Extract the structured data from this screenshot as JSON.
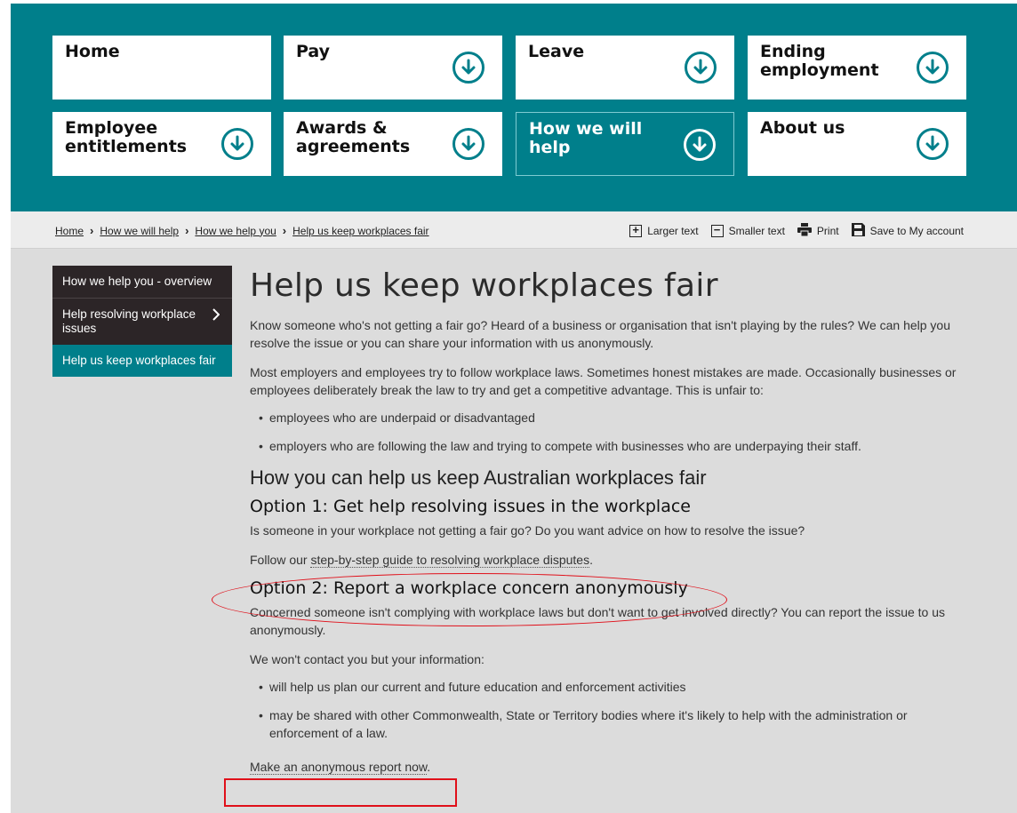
{
  "nav": {
    "tiles": [
      {
        "label": "Home",
        "has_icon": false
      },
      {
        "label": "Pay",
        "has_icon": true
      },
      {
        "label": "Leave",
        "has_icon": true
      },
      {
        "label": "Ending employment",
        "has_icon": true
      },
      {
        "label": "Employee entitlements",
        "has_icon": true
      },
      {
        "label": "Awards & agreements",
        "has_icon": true
      },
      {
        "label": "How we will help",
        "has_icon": true,
        "active": true
      },
      {
        "label": "About us",
        "has_icon": true
      }
    ],
    "icon": "down-arrow-circle-icon",
    "accent_color": "#007f8b"
  },
  "breadcrumb": {
    "items": [
      "Home",
      "How we will help",
      "How we help you",
      "Help us keep workplaces fair"
    ]
  },
  "tools": {
    "larger": "Larger text",
    "smaller": "Smaller text",
    "print": "Print",
    "save": "Save to My account"
  },
  "sidenav": {
    "items": [
      {
        "label": "How we help you - overview"
      },
      {
        "label": "Help resolving workplace issues"
      },
      {
        "label": "Help us keep workplaces fair"
      }
    ]
  },
  "main": {
    "title": "Help us keep workplaces fair",
    "intro": "Know someone who's not getting a fair go? Heard of a business or organisation that isn't playing by the rules? We can help you resolve the issue or you can share your information with us anonymously.",
    "para2": "Most employers and employees try to follow workplace laws. Sometimes honest mistakes are made. Occasionally businesses or employees deliberately break the law to try and get a competitive advantage. This is unfair to:",
    "list1": [
      "employees who are underpaid or disadvantaged",
      "employers who are following the law and trying to compete with businesses who are underpaying their staff."
    ],
    "h2": "How you can help us keep Australian workplaces fair",
    "option1_title": "Option 1: Get help resolving issues in the workplace",
    "option1_text": "Is someone in your workplace not getting a fair go? Do you want advice on how to resolve the issue?",
    "option1_link_prefix": "Follow our ",
    "option1_link": "step-by-step guide to resolving workplace disputes",
    "option1_link_suffix": ".",
    "option2_title": "Option 2: Report a workplace concern anonymously",
    "option2_text": "Concerned someone isn't complying with workplace laws but don't want to get involved directly? You can report the issue to us anonymously.",
    "option2_text2": "We won't contact you but your information:",
    "list2": [
      "will help us plan our current and future education and enforcement activities",
      "may be shared with other Commonwealth, State or Territory bodies where it's likely to help with the administration or enforcement of a law."
    ],
    "report_link": "Make an anonymous report now",
    "report_suffix": "."
  }
}
